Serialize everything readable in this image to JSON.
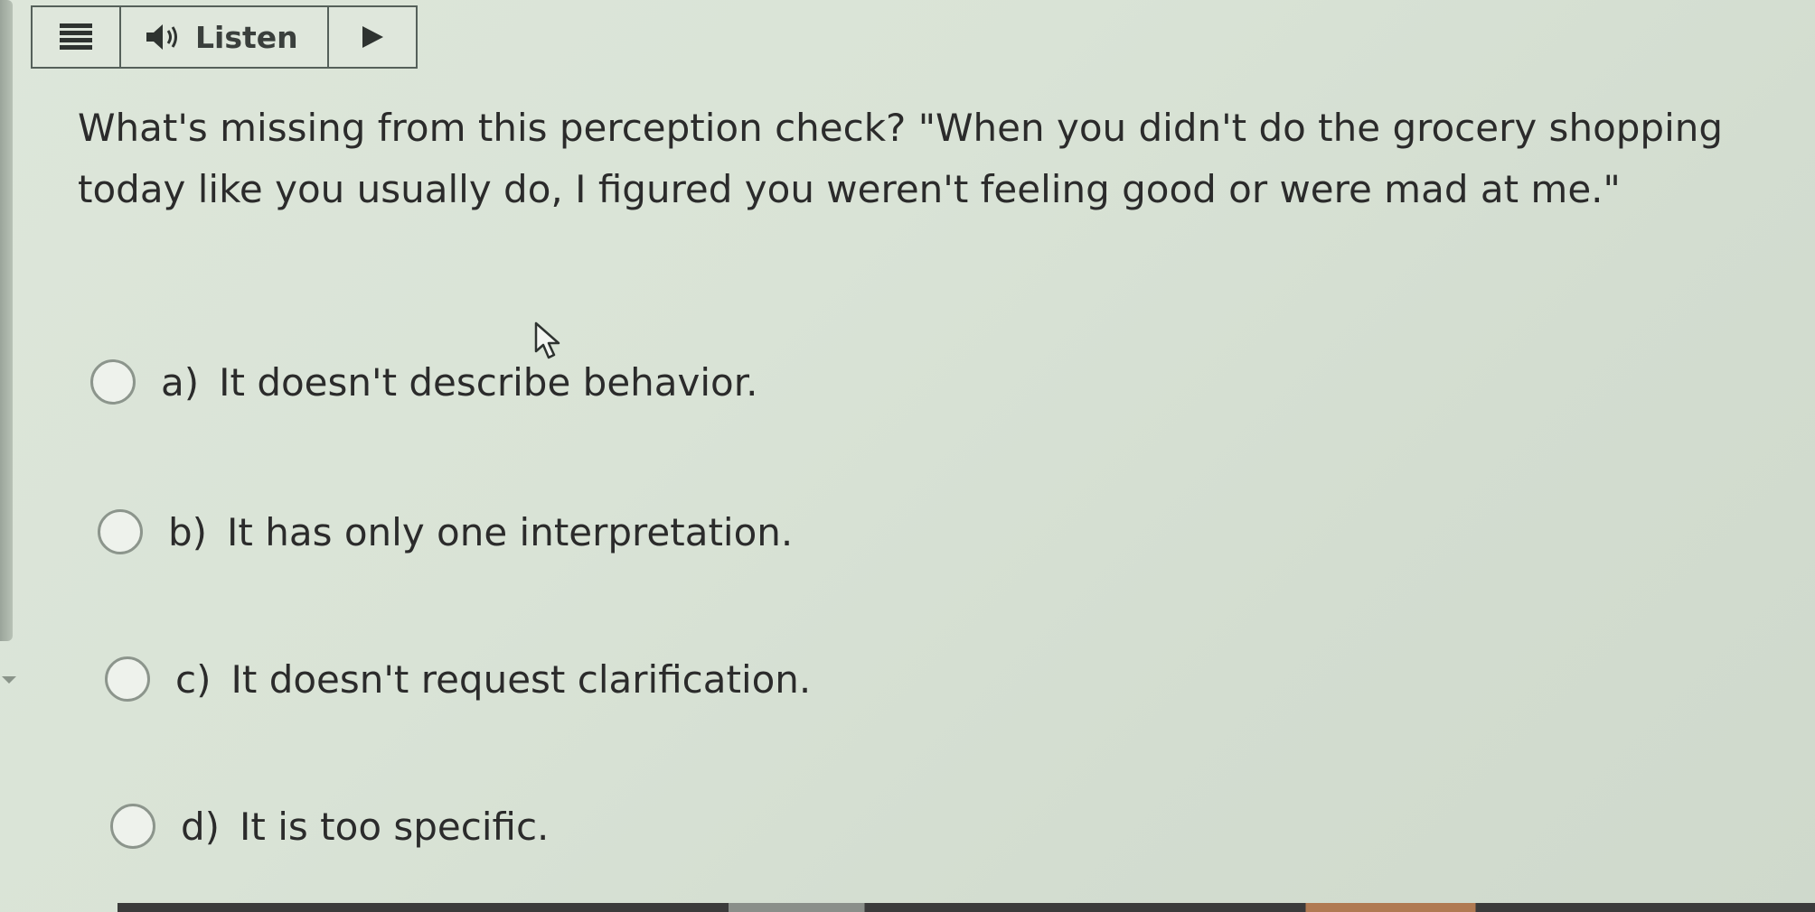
{
  "toolbar": {
    "menu_icon": "hamburger-menu-icon",
    "speaker_icon": "speaker-icon",
    "listen_label": "Listen",
    "play_icon": "play-icon"
  },
  "question": {
    "text": "What's missing from this perception check? \"When you didn't do the grocery shopping today like you usually do, I figured you weren't feeling good or were mad at me.\""
  },
  "options": [
    {
      "letter": "a)",
      "text": "It doesn't describe behavior.",
      "selected": false
    },
    {
      "letter": "b)",
      "text": "It has only one interpretation.",
      "selected": false
    },
    {
      "letter": "c)",
      "text": "It doesn't request clarification.",
      "selected": false
    },
    {
      "letter": "d)",
      "text": "It is too specific.",
      "selected": false
    }
  ],
  "colors": {
    "background": "#d9e3d6",
    "text": "#2b2b2b",
    "radio_border": "#8c958c",
    "toolbar_border": "#55605a"
  }
}
